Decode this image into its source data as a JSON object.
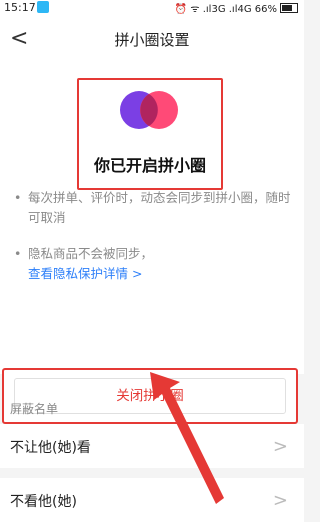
{
  "status_bar": {
    "time": "15:17",
    "right_text": "⏰ ᯤ .ıl3G .ıl4G 66%"
  },
  "nav": {
    "back_icon": "chevron-left-icon",
    "title": "拼小圈设置"
  },
  "hero": {
    "logo_icon": "pinxiaoquan-logo-icon",
    "text": "你已开启拼小圈"
  },
  "tips": [
    {
      "text": "每次拼单、评价时，动态会同步到拼小圈，随时可取消"
    },
    {
      "text": "隐私商品不会被同步，",
      "link": "查看隐私保护详情 >"
    }
  ],
  "close_button": {
    "label": "关闭拼小圈"
  },
  "blocklist": {
    "title": "屏蔽名单",
    "items": [
      {
        "label": "不让他(她)看"
      },
      {
        "label": "不看他(她)"
      }
    ]
  },
  "colors": {
    "accent_red": "#e53935",
    "link_blue": "#2d7ff9",
    "logo_purple": "#7b3fe4",
    "logo_pink": "#ff3b6b"
  }
}
